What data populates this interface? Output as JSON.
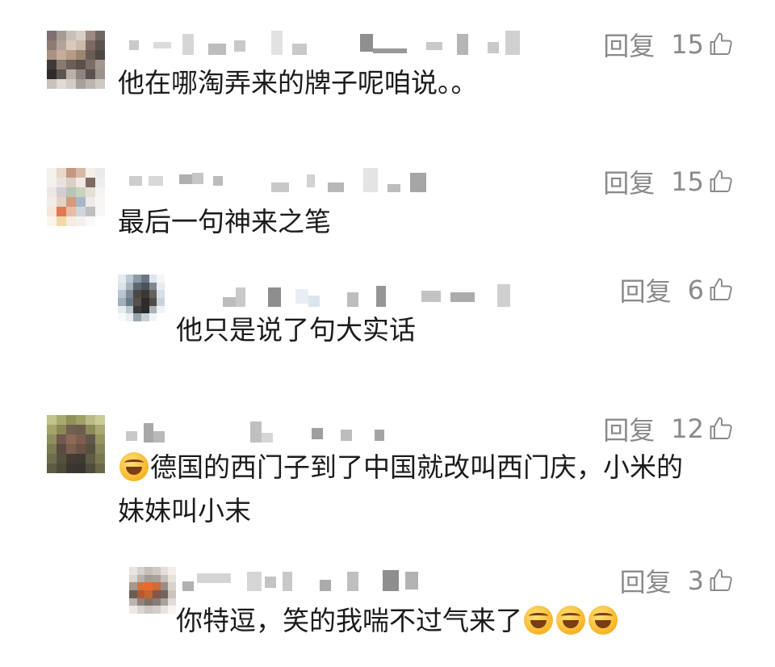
{
  "colors": {
    "meta": "#8a8a8a",
    "text": "#1b1b1b",
    "background": "#ffffff"
  },
  "comments": [
    {
      "reply_label": "回复",
      "likes": "15",
      "text": "他在哪淘弄来的牌子呢咱说。。"
    },
    {
      "reply_label": "回复",
      "likes": "15",
      "text": "最后一句神来之笔"
    },
    {
      "reply_label": "回复",
      "likes": "6",
      "text": "他只是说了句大实话"
    },
    {
      "reply_label": "回复",
      "likes": "12",
      "emoji": "face-palm-laugh-emoji",
      "text": "德国的西门子到了中国就改叫西门庆，小米的",
      "text_line2": "妹妹叫小末"
    },
    {
      "reply_label": "回复",
      "likes": "3",
      "text": "你特逗，笑的我喘不过气来了",
      "emoji": "laughing-crying-emoji"
    }
  ]
}
